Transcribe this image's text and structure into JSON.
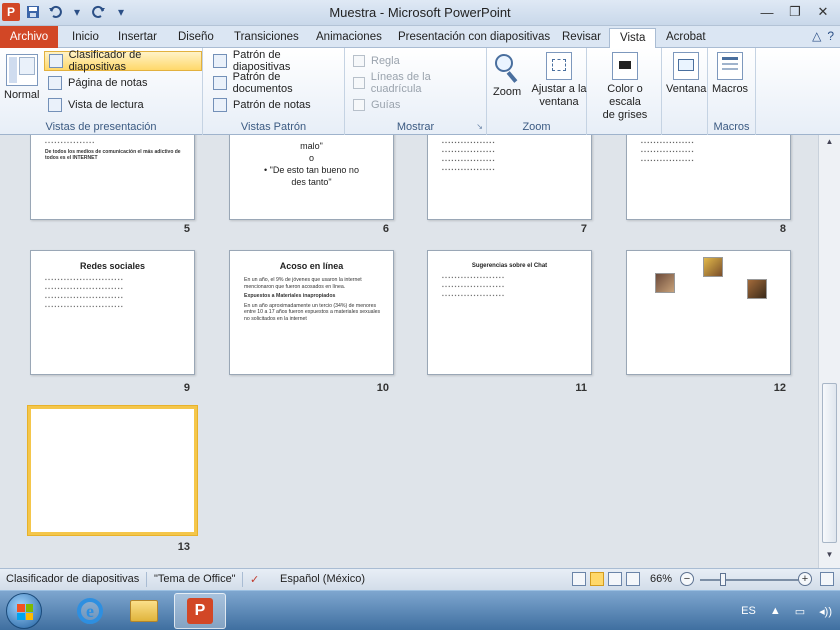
{
  "window": {
    "title": "Muestra - Microsoft PowerPoint",
    "app_letter": "P"
  },
  "qat": {
    "save_icon": "save-icon",
    "undo_icon": "undo-icon",
    "redo_icon": "redo-icon",
    "customize_icon": "chevron-down-icon"
  },
  "tabs": [
    {
      "label": "Archivo"
    },
    {
      "label": "Inicio"
    },
    {
      "label": "Insertar"
    },
    {
      "label": "Diseño"
    },
    {
      "label": "Transiciones"
    },
    {
      "label": "Animaciones"
    },
    {
      "label": "Presentación con diapositivas"
    },
    {
      "label": "Revisar"
    },
    {
      "label": "Vista"
    },
    {
      "label": "Acrobat"
    }
  ],
  "ribbon": {
    "presentation_views": {
      "label": "Vistas de presentación",
      "normal": "Normal",
      "sorter": "Clasificador de diapositivas",
      "notes_page": "Página de notas",
      "reading": "Vista de lectura"
    },
    "master_views": {
      "label": "Vistas Patrón",
      "slide_master": "Patrón de diapositivas",
      "handout_master": "Patrón de documentos",
      "notes_master": "Patrón de notas"
    },
    "show": {
      "label": "Mostrar",
      "ruler": "Regla",
      "gridlines": "Líneas de la cuadrícula",
      "guides": "Guías"
    },
    "zoom": {
      "label": "Zoom",
      "zoom": "Zoom",
      "fit": "Ajustar a la ventana"
    },
    "color": {
      "label": "Color o escala de grises",
      "label_line1": "Color o escala",
      "label_line2": "de grises"
    },
    "window": {
      "label": "Ventana"
    },
    "macros": {
      "label": "Macros",
      "group": "Macros"
    }
  },
  "slides": [
    {
      "number": "5",
      "lines": [
        "De todos los medios de comunicación el más adictivo de todos es el INTERNET"
      ]
    },
    {
      "number": "6",
      "lines": [
        "malo\"",
        "o",
        "• \"De esto tan bueno no",
        "des tanto\""
      ]
    },
    {
      "number": "7",
      "lines": []
    },
    {
      "number": "8",
      "lines": []
    },
    {
      "number": "9",
      "title": "Redes sociales"
    },
    {
      "number": "10",
      "title": "Acoso en línea",
      "bullets": [
        "En un año, el 9% de jóvenes que usaron la internet mencionaron que fueron acosados en línea.",
        "Expuestos a Materiales inapropiados",
        "En un año aproximadamente un tercio (34%) de menores entre 10 a 17 años fueron expuestos a materiales sexuales no solicitados en la internet"
      ]
    },
    {
      "number": "11",
      "title": "Sugerencias sobre el Chat"
    },
    {
      "number": "12"
    },
    {
      "number": "13"
    }
  ],
  "status": {
    "view": "Clasificador de diapositivas",
    "theme": "\"Tema de Office\"",
    "language": "Español (México)",
    "zoom_level": "66%"
  },
  "taskbar": {
    "lang": "ES"
  },
  "colors": {
    "file_tab": "#d24726",
    "active_highlight": "#ffd86a",
    "selected_slide_border": "#f4c64b"
  }
}
